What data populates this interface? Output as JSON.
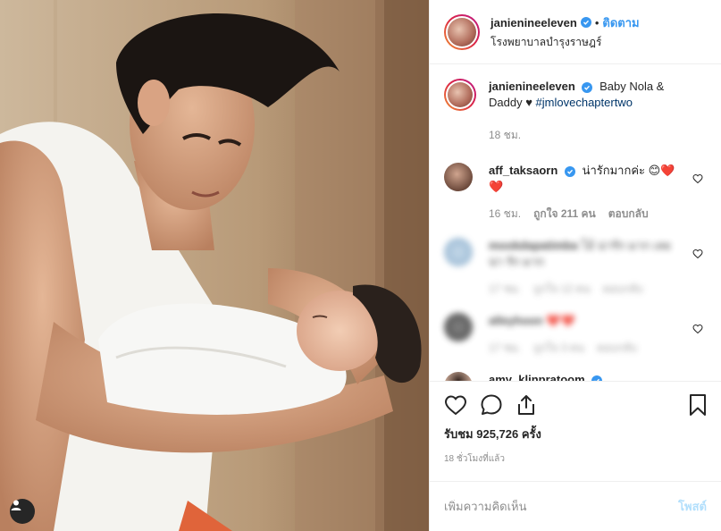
{
  "post": {
    "username": "janienineeleven",
    "follow_label": "ติดตาม",
    "location": "โรงพยาบาลบำรุงราษฎร์",
    "caption_text": "Baby Nola & Daddy ♥",
    "caption_hashtag": "#jmlovechaptertwo",
    "caption_time": "18 ชม.",
    "views_label": "รับชม 925,726 ครั้ง",
    "time_ago": "18 ชั่วโมงที่แล้ว",
    "media_icon": "user-tag-icon"
  },
  "comments": [
    {
      "username": "aff_taksaorn",
      "text": "น่ารักมากค่ะ 😊❤️❤️",
      "time": "16 ชม.",
      "likes": "ถูกใจ 211 คน",
      "reply": "ตอบกลับ",
      "blurred": false
    },
    {
      "username": "mookdapatimba",
      "text": "โอ้ น่ารัก มาก เลย น่า รัก มาก",
      "time": "17 ชม.",
      "likes": "ถูกใจ 12 คน",
      "reply": "ตอบกลับ",
      "blurred": true
    },
    {
      "username": "alleyhoon",
      "text": "❤️❤️",
      "time": "17 ชม.",
      "likes": "ถูกใจ 3 คน",
      "reply": "ตอบกลับ",
      "blurred": true
    },
    {
      "username": "amy_klinpratoom",
      "text": "",
      "blurred": false
    }
  ],
  "composer": {
    "placeholder": "เพิ่มความคิดเห็น",
    "post_label": "โพสต์"
  },
  "colors": {
    "accent": "#3897f0",
    "hashtag": "#003569",
    "muted": "#8e8e8e"
  }
}
